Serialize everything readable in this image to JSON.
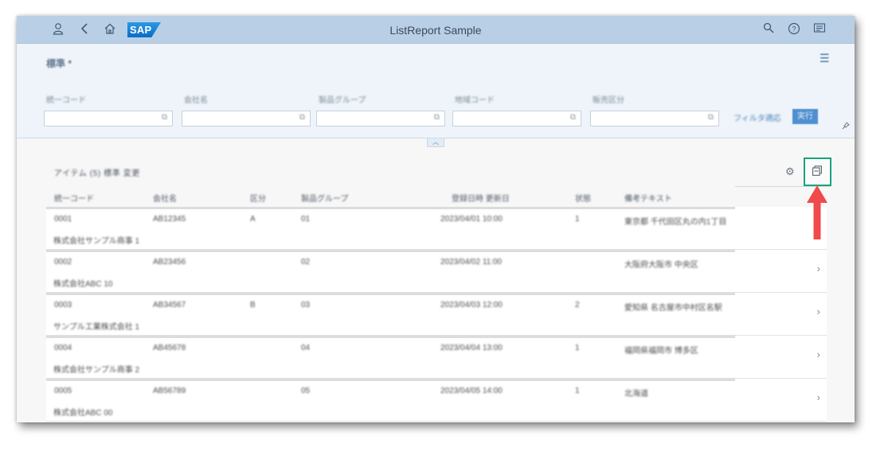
{
  "shell": {
    "title": "ListReport Sample",
    "left_icons": [
      "user-icon",
      "back-icon",
      "home-icon"
    ],
    "logo_text": "SAP",
    "right_icons": [
      "search-icon",
      "help-icon",
      "notifications-icon"
    ]
  },
  "header": {
    "variant_title": "標準 *",
    "filters": [
      {
        "label": "統一コード",
        "value": ""
      },
      {
        "label": "会社名",
        "value": ""
      },
      {
        "label": "製品グループ",
        "value": ""
      },
      {
        "label": "地域コード",
        "value": ""
      },
      {
        "label": "販売区分",
        "value": ""
      }
    ],
    "value_help_glyph": "⧉",
    "adapt_filters_label": "フィルタ適応",
    "go_label": "実行"
  },
  "table": {
    "title": "アイテム (5) 標準 変更",
    "columns": [
      "統一コード",
      "会社名",
      "区分",
      "製品グループ",
      "登録日時 更新日",
      "状態",
      "備考テキスト"
    ],
    "rows": [
      {
        "cells": [
          "0001",
          "AB12345",
          "A",
          "01",
          "2023/04/01 10:00",
          "1",
          "東京都 千代田区丸の内1丁目"
        ],
        "sub": "株式会社サンプル商事 1"
      },
      {
        "cells": [
          "0002",
          "AB23456",
          "",
          "02",
          "2023/04/02 11:00",
          "",
          "大阪府大阪市 中央区"
        ],
        "sub": "株式会社ABC 10"
      },
      {
        "cells": [
          "0003",
          "AB34567",
          "B",
          "03",
          "2023/04/03 12:00",
          "2",
          "愛知県 名古屋市中村区名駅"
        ],
        "sub": "サンプル工業株式会社 1"
      },
      {
        "cells": [
          "0004",
          "AB45678",
          "",
          "04",
          "2023/04/04 13:00",
          "1",
          "福岡県福岡市 博多区"
        ],
        "sub": "株式会社サンプル商事 2"
      },
      {
        "cells": [
          "0005",
          "AB56789",
          "",
          "05",
          "2023/04/05 14:00",
          "1",
          "北海道"
        ],
        "sub": "株式会社ABC 00"
      }
    ],
    "row_nav_glyph": "›"
  },
  "annotation": {
    "highlight_color": "#19a37c",
    "arrow_color": "#f04a4a"
  }
}
